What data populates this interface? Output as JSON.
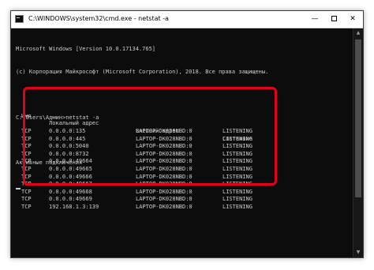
{
  "window": {
    "title": "C:\\WINDOWS\\system32\\cmd.exe - netstat  -a",
    "minimize_glyph": "—",
    "close_glyph": "✕"
  },
  "console": {
    "version_line": "Microsoft Windows [Version 10.0.17134.765]",
    "copyright_line": "(c) Корпорация Майкрософт (Microsoft Corporation), 2018. Все права защищены.",
    "prompt_line": "C:\\Users\\Админ>netstat -a",
    "section_header": "Активные подключения",
    "table": {
      "headers": [
        "Имя",
        "Локальный адрес",
        "Внешний адрес",
        "Состояние"
      ],
      "rows": [
        [
          "TCP",
          "0.0.0.0:135",
          "LAPTOP-DK028NBD:0",
          "LISTENING"
        ],
        [
          "TCP",
          "0.0.0.0:445",
          "LAPTOP-DK028NBD:0",
          "LISTENING"
        ],
        [
          "TCP",
          "0.0.0.0:5040",
          "LAPTOP-DK028NBD:0",
          "LISTENING"
        ],
        [
          "TCP",
          "0.0.0.0:8732",
          "LAPTOP-DK028NBD:0",
          "LISTENING"
        ],
        [
          "TCP",
          "0.0.0.0:49664",
          "LAPTOP-DK028NBD:0",
          "LISTENING"
        ],
        [
          "TCP",
          "0.0.0.0:49665",
          "LAPTOP-DK028NBD:0",
          "LISTENING"
        ],
        [
          "TCP",
          "0.0.0.0:49666",
          "LAPTOP-DK028NBD:0",
          "LISTENING"
        ],
        [
          "TCP",
          "0.0.0.0:49667",
          "LAPTOP-DK028NBD:0",
          "LISTENING"
        ],
        [
          "TCP",
          "0.0.0.0:49668",
          "LAPTOP-DK028NBD:0",
          "LISTENING"
        ],
        [
          "TCP",
          "0.0.0.0:49669",
          "LAPTOP-DK028NBD:0",
          "LISTENING"
        ],
        [
          "TCP",
          "192.168.1.3:139",
          "LAPTOP-DK028NBD:0",
          "LISTENING"
        ]
      ]
    }
  },
  "colors": {
    "console_bg": "#0c0c0c",
    "console_text": "#cccccc",
    "highlight_border": "#e3001b"
  },
  "icons": {
    "app_icon": "cmd-icon",
    "minimize": "minimize-icon",
    "maximize": "maximize-icon",
    "close": "close-icon",
    "scroll_up": "arrow-up-icon",
    "scroll_down": "arrow-down-icon"
  }
}
